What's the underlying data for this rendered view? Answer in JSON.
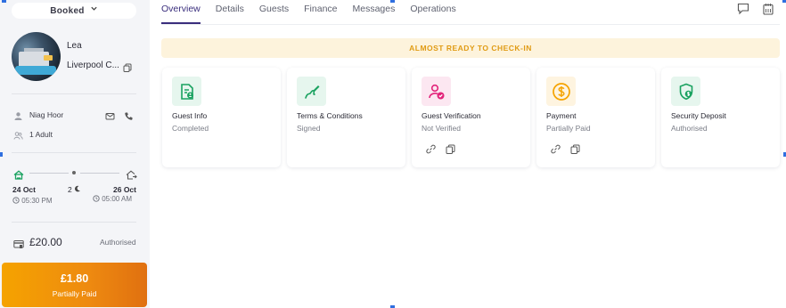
{
  "sidebar": {
    "status": "Booked",
    "guest_first_name": "Lea",
    "property_name": "Liverpool C...",
    "host_name": "Niag Hoor",
    "guests_count": "1 Adult",
    "checkin_date": "24 Oct",
    "checkin_time": "05:30 PM",
    "nights": "2",
    "checkout_date": "26 Oct",
    "checkout_time": "05:00 AM",
    "price": "£20.00",
    "price_status": "Authorised",
    "paid_amount": "£1.80",
    "paid_status": "Partially Paid"
  },
  "tabs": [
    "Overview",
    "Details",
    "Guests",
    "Finance",
    "Messages",
    "Operations"
  ],
  "active_tab": "Overview",
  "banner": "ALMOST READY TO CHECK-IN",
  "cards": [
    {
      "title": "Guest Info",
      "status": "Completed",
      "icon": "guest-info-icon",
      "color": "#1aa260"
    },
    {
      "title": "Terms & Conditions",
      "status": "Signed",
      "icon": "signature-icon",
      "color": "#1aa260"
    },
    {
      "title": "Guest Verification",
      "status": "Not Verified",
      "icon": "user-check-icon",
      "color": "#e2237a"
    },
    {
      "title": "Payment",
      "status": "Partially Paid",
      "icon": "dollar-icon",
      "color": "#f5a300"
    },
    {
      "title": "Security Deposit",
      "status": "Authorised",
      "icon": "shield-dollar-icon",
      "color": "#1aa260"
    }
  ],
  "colors": {
    "accent": "#3a2e7d",
    "banner_text": "#e09b14",
    "banner_bg": "#fdf3dc",
    "paid_gradient_start": "#f5a300",
    "paid_gradient_end": "#e07010"
  }
}
